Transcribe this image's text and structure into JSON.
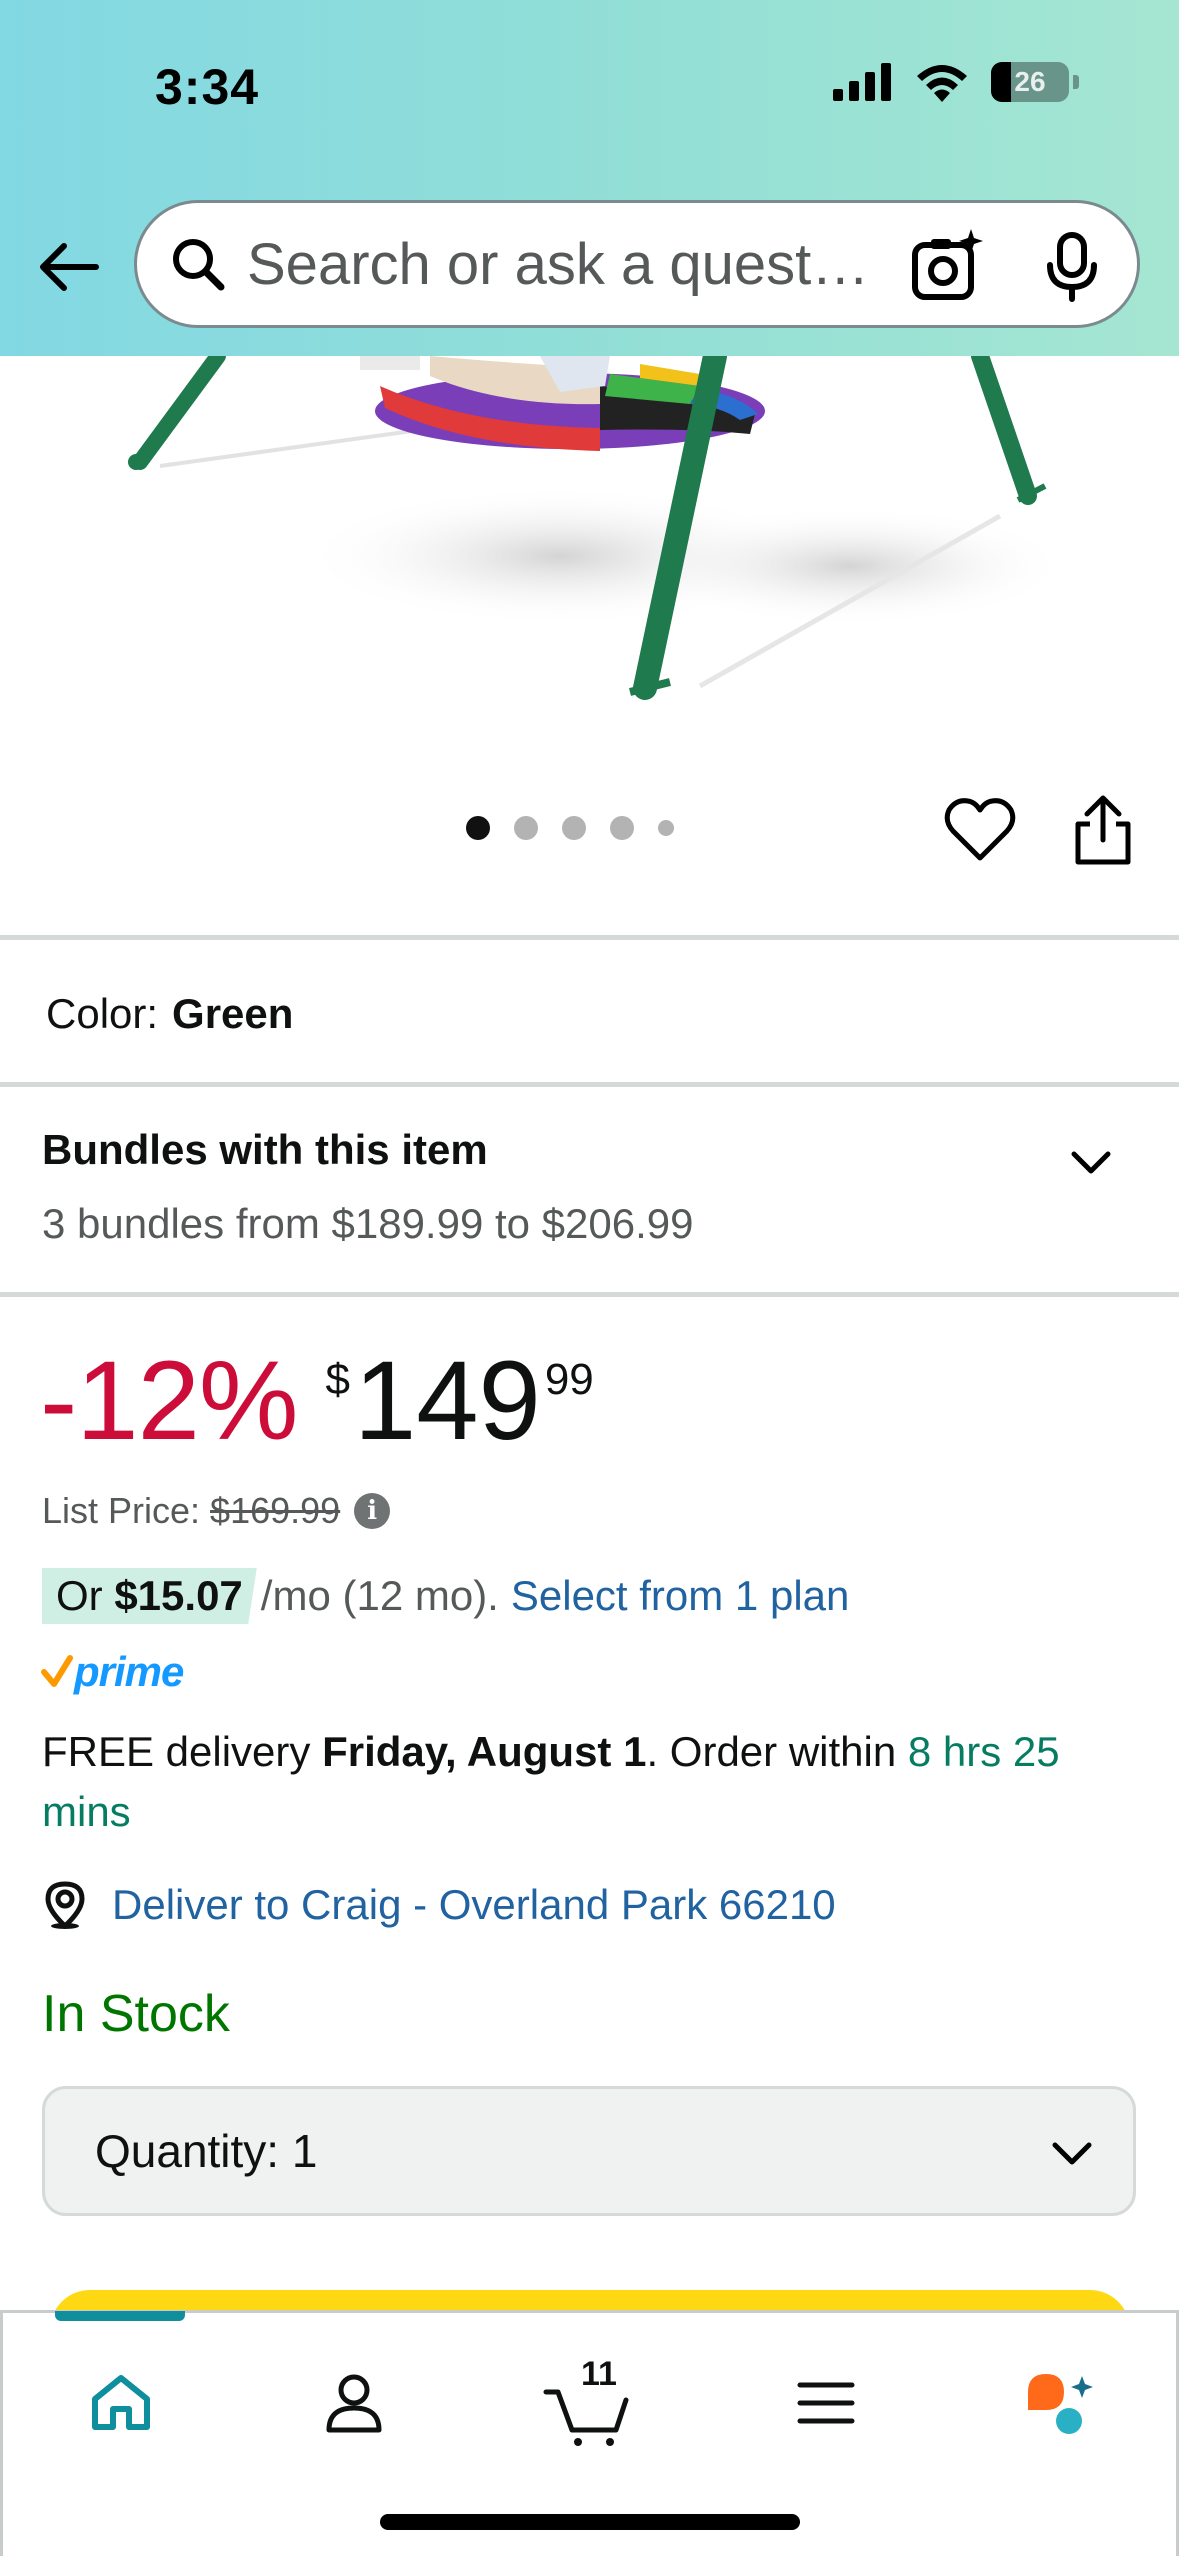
{
  "status_bar": {
    "time": "3:34",
    "battery": "26"
  },
  "search": {
    "placeholder": "Search or ask a question"
  },
  "product": {
    "image_count": 5,
    "active_image": 1
  },
  "color": {
    "label": "Color:",
    "value": "Green"
  },
  "bundles": {
    "title": "Bundles with this item",
    "subtitle": "3 bundles from $189.99 to $206.99"
  },
  "price": {
    "discount": "-12%",
    "symbol": "$",
    "whole": "149",
    "fraction": "99",
    "list_label": "List Price:",
    "list_value": "$169.99"
  },
  "monthly": {
    "prefix": "Or ",
    "amount": "$15.07",
    "term": "/mo (12 mo).",
    "plan_link": "Select from 1 plan"
  },
  "prime": {
    "label": "prime"
  },
  "delivery": {
    "prefix": "FREE delivery ",
    "date": "Friday, August 1",
    "middle": ". Order within ",
    "countdown": "8 hrs 25 mins"
  },
  "deliver_to": "Deliver to Craig - Overland Park 66210",
  "stock": "In Stock",
  "quantity": {
    "label": "Quantity:",
    "value": "1"
  },
  "bottom_nav": {
    "cart_count": "11",
    "items": [
      "home",
      "account",
      "cart",
      "menu",
      "rufus"
    ]
  },
  "colors": {
    "header_gradient_start": "#82d8e3",
    "header_gradient_end": "#a5e6d2",
    "discount": "#cc0c39",
    "link": "#2162a1",
    "in_stock": "#007600",
    "countdown": "#067d62",
    "add_to_cart": "#ffd814",
    "nav_accent": "#0f8f9e"
  }
}
